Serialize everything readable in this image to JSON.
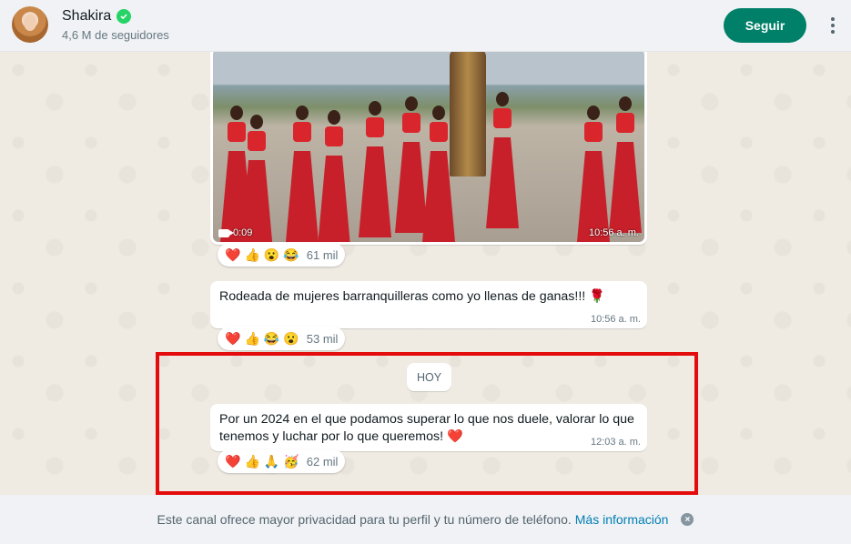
{
  "header": {
    "channel_name": "Shakira",
    "followers": "4,6 M de seguidores",
    "follow_label": "Seguir",
    "verified_icon": "verified-check-icon",
    "menu_icon": "kebab-menu-icon"
  },
  "messages": [
    {
      "type": "video",
      "duration": "0:09",
      "time": "10:56 a. m.",
      "reactions": [
        "❤️",
        "👍",
        "😮",
        "😂"
      ],
      "reaction_count": "61 mil"
    },
    {
      "type": "text",
      "text": "Rodeada de mujeres barranquilleras como yo llenas de ganas!!! 🌹",
      "time": "10:56 a. m.",
      "reactions": [
        "❤️",
        "👍",
        "😂",
        "😮"
      ],
      "reaction_count": "53 mil"
    },
    {
      "type": "text",
      "text": "Por un 2024 en el que podamos superar lo que nos duele, valorar lo que tenemos y luchar por lo que queremos! ❤️",
      "time": "12:03 a. m.",
      "reactions": [
        "❤️",
        "👍",
        "🙏",
        "🥳"
      ],
      "reaction_count": "62 mil"
    }
  ],
  "date_divider": "HOY",
  "footer": {
    "notice": "Este canal ofrece mayor privacidad para tu perfil y tu número de teléfono.",
    "link": "Más información"
  },
  "colors": {
    "accent": "#008069",
    "highlight": "#e30b0b",
    "chat_bg": "#efeae2"
  }
}
